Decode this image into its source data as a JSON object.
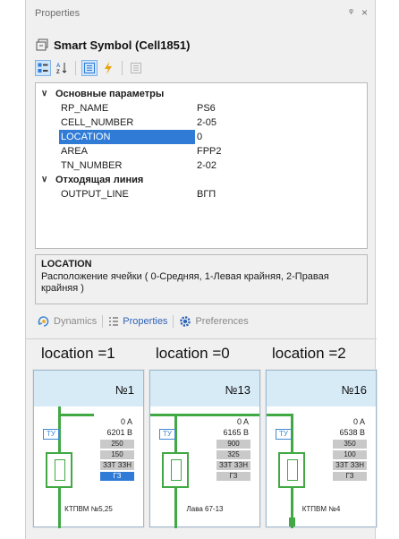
{
  "panel": {
    "title": "Properties",
    "pin_glyph": "ᵠ",
    "close_glyph": "×",
    "object_name": "Smart Symbol (Cell1851)"
  },
  "grid": {
    "categories": [
      {
        "label": "Основные параметры",
        "props": [
          {
            "key": "RP_NAME",
            "value": "PS6"
          },
          {
            "key": "CELL_NUMBER",
            "value": "2-05"
          },
          {
            "key": "LOCATION",
            "value": "0"
          },
          {
            "key": "AREA",
            "value": "FPP2"
          },
          {
            "key": "TN_NUMBER",
            "value": "2-02"
          }
        ]
      },
      {
        "label": "Отходящая линия",
        "props": [
          {
            "key": "OUTPUT_LINE",
            "value": "ВГП"
          }
        ]
      }
    ]
  },
  "description": {
    "title": "LOCATION",
    "text": "Расположение ячейки ( 0-Средняя, 1-Левая крайняя, 2-Правая крайняя )"
  },
  "tabs": [
    {
      "label": "Dynamics",
      "icon": "dynamics-icon"
    },
    {
      "label": "Properties",
      "icon": "properties-icon"
    },
    {
      "label": "Preferences",
      "icon": "preferences-icon"
    }
  ],
  "cells": [
    {
      "location_label": "location =1",
      "number": "№1",
      "amp": "0 A",
      "volt": "6201 B",
      "v1": "250",
      "v2": "150",
      "v3": "ЗЗТ ЗЗН",
      "v4": "ГЗ",
      "caption": "КТПВМ №5,25",
      "ty": "ТУ"
    },
    {
      "location_label": "location =0",
      "number": "№13",
      "amp": "0 A",
      "volt": "6165 B",
      "v1": "900",
      "v2": "325",
      "v3": "ЗЗТ ЗЗН",
      "v4": "ГЗ",
      "caption": "Лава 67-13",
      "ty": "ТУ"
    },
    {
      "location_label": "location =2",
      "number": "№16",
      "amp": "0 A",
      "volt": "6538 B",
      "v1": "350",
      "v2": "100",
      "v3": "ЗЗТ ЗЗН",
      "v4": "ГЗ",
      "caption": "КТПВМ №4",
      "ty": "ТУ"
    }
  ],
  "colors": {
    "selection": "#2f7bd6",
    "accent_blue": "#2e63b8",
    "line_green": "#40a944",
    "cell_header": "#d7ebf7"
  }
}
